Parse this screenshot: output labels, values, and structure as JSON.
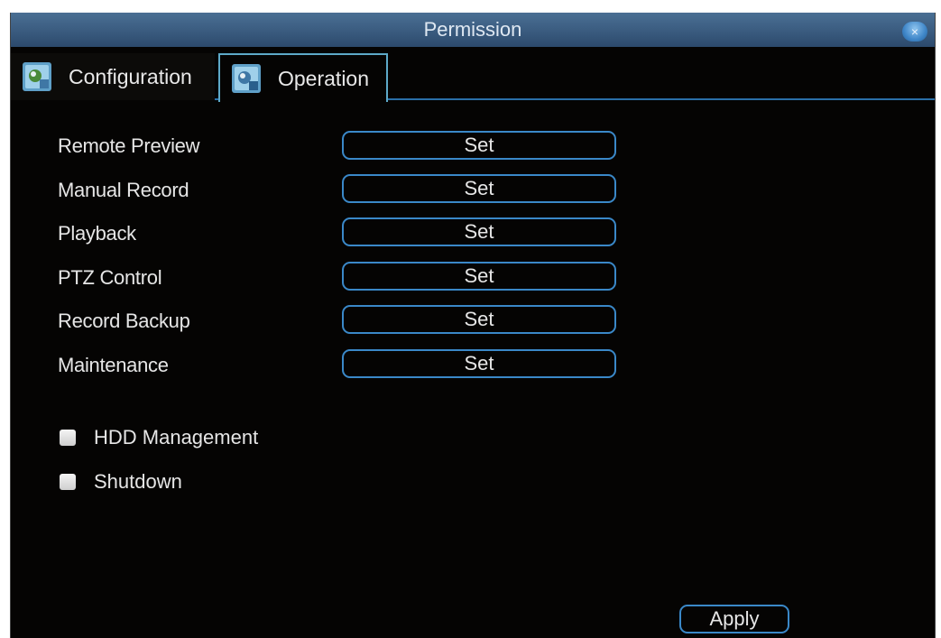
{
  "window": {
    "title": "Permission",
    "close_icon": "close-icon",
    "close_glyph": "×"
  },
  "tabs": [
    {
      "label": "Configuration",
      "icon": "settings-tab-icon",
      "selected": false
    },
    {
      "label": "Operation",
      "icon": "operation-tab-icon",
      "selected": true
    }
  ],
  "permissions": [
    {
      "label": "Remote Preview",
      "button": "Set"
    },
    {
      "label": "Manual Record",
      "button": "Set"
    },
    {
      "label": "Playback",
      "button": "Set"
    },
    {
      "label": "PTZ Control",
      "button": "Set"
    },
    {
      "label": "Record Backup",
      "button": "Set"
    },
    {
      "label": "Maintenance",
      "button": "Set"
    }
  ],
  "checkboxes": [
    {
      "label": "HDD Management",
      "checked": false
    },
    {
      "label": "Shutdown",
      "checked": false
    }
  ],
  "footer": {
    "apply_label": "Apply"
  },
  "colors": {
    "background": "#050403",
    "title_bar": "#3d5f83",
    "accent": "#3a88c8",
    "text": "#e6e6e6"
  }
}
